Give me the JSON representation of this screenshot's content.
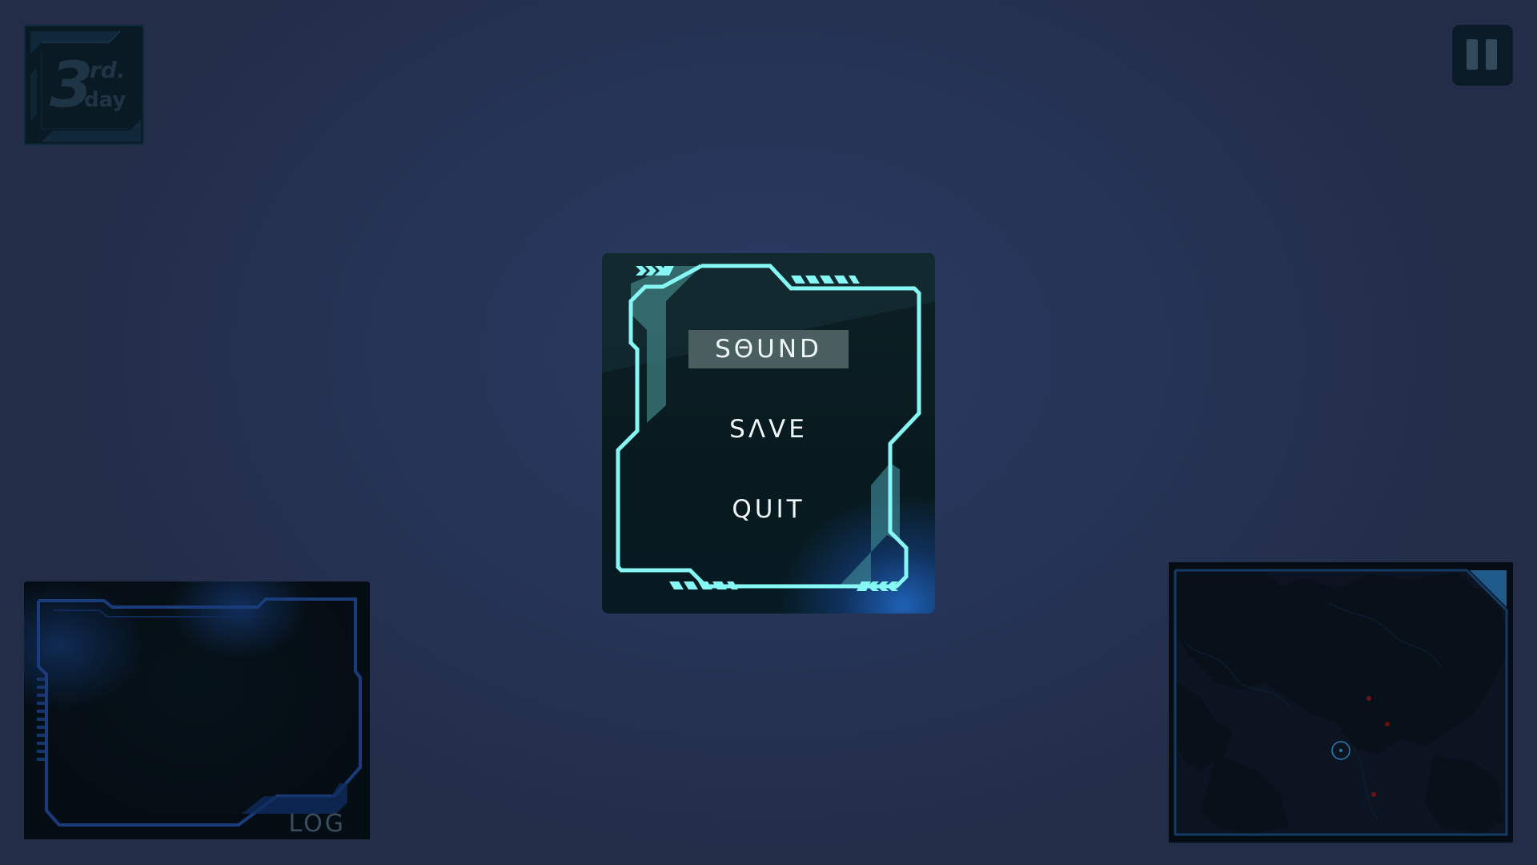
{
  "hud": {
    "day": {
      "number": "3",
      "suffix": "rd.",
      "word": "day"
    },
    "log_label": "LOG"
  },
  "pause_menu": {
    "selected_index": 0,
    "items": [
      {
        "label": "SΘUND"
      },
      {
        "label": "SΛVE"
      },
      {
        "label": "QUIT"
      }
    ]
  },
  "colors": {
    "accent": "#7ef4f2",
    "panel": "#081a1f",
    "background": "#263558",
    "glow": "#2f7fe0",
    "selection": "#4a5d5f",
    "map_marker": "#7a1010"
  },
  "icons": {
    "pause": "pause-icon",
    "map_locator": "crosshair-circle-icon"
  }
}
